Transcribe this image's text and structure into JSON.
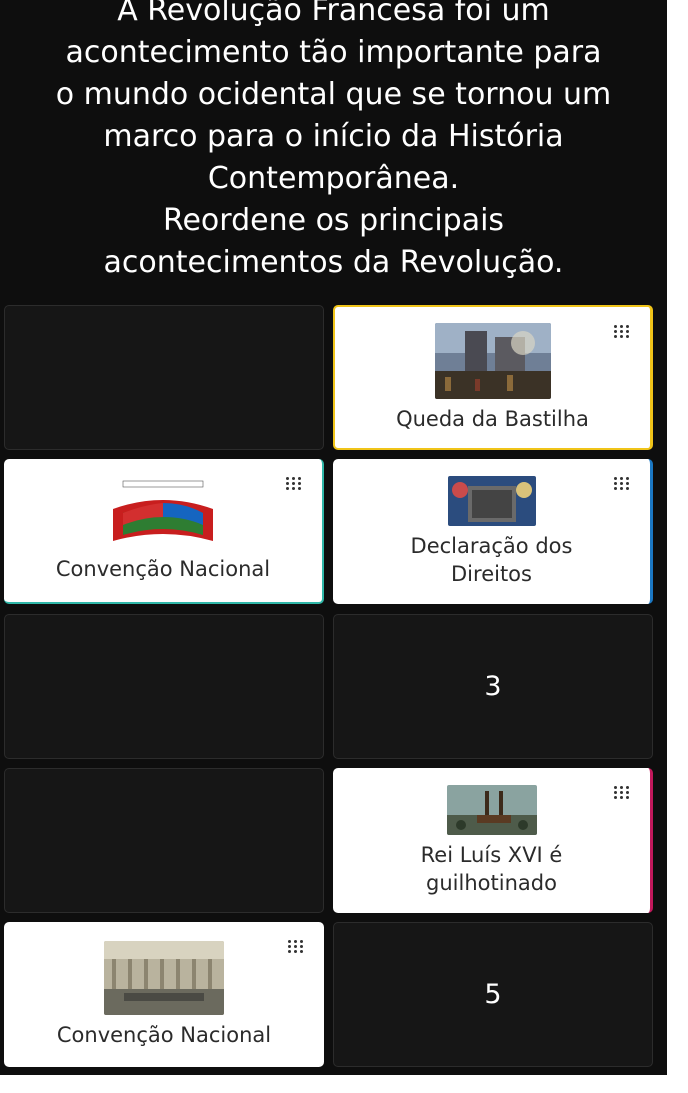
{
  "question": {
    "lines": [
      "A Revolução Francesa foi um",
      "acontecimento tão importante para",
      "o mundo ocidental que se tornou um",
      "marco para o início da História",
      "Contemporânea.",
      "Reordene os principais",
      "acontecimentos da Revolução."
    ]
  },
  "cards": {
    "queda": {
      "label": "Queda da Bastilha",
      "accent": "#f0c419"
    },
    "convencao1": {
      "label": "Convenção Nacional",
      "accent": "#2fb7a8"
    },
    "declaracao": {
      "label_line1": "Declaração dos",
      "label_line2": "Direitos",
      "accent": "#1b78c4"
    },
    "rei": {
      "label_line1": "Rei Luís XVI é",
      "label_line2": "guilhotinado",
      "accent": "#c2185b"
    },
    "convencao2": {
      "label": "Convenção Nacional"
    }
  },
  "slots": {
    "slot3": "3",
    "slot5": "5"
  },
  "icons": {
    "drag": "drag-handle-icon"
  }
}
